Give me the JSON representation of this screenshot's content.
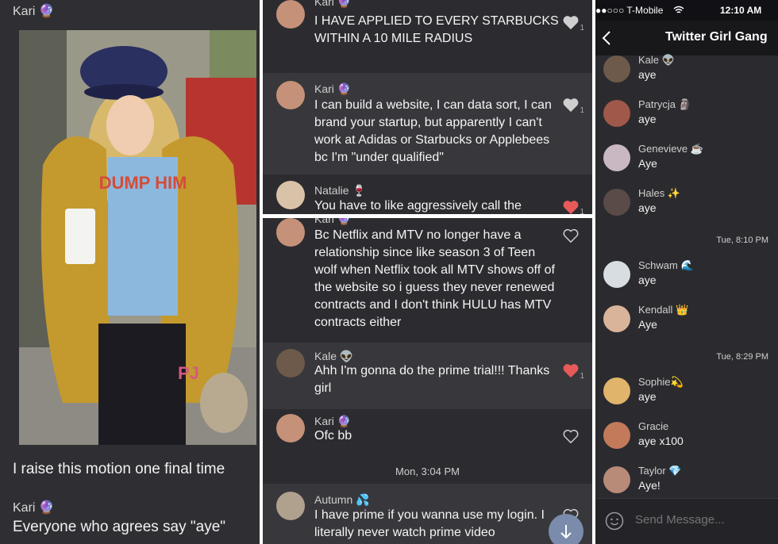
{
  "panel1": {
    "sender_top": "Kari 🔮",
    "photo_shirt_text": "DUMP HIM",
    "photo_pants_text": "PJ",
    "message1": "I raise this motion one final time",
    "sender2": "Kari 🔮",
    "message2": "Everyone who agrees say \"aye\""
  },
  "panel2": {
    "messages": [
      {
        "name": "Kari 🔮",
        "text": "I HAVE APPLIED TO EVERY STARBUCKS WITHIN A 10 MILE RADIUS",
        "likes": "1"
      },
      {
        "name": "Kari 🔮",
        "text": "I can build a website, I can data sort, I can brand your startup, but apparently I can't work at Adidas or Starbucks or Applebees bc I'm \"under qualified\"",
        "likes": "1"
      },
      {
        "name": "Natalie 🍷",
        "text": "You have to like aggressively call the",
        "likes": "1"
      }
    ]
  },
  "panel3": {
    "messages": [
      {
        "name": "Kari 🔮",
        "text": "Bc Netflix and MTV no longer have a relationship since like season 3 of Teen wolf when Netflix took all MTV shows off of the website so i guess they never renewed contracts and I don't think HULU has MTV contracts either"
      },
      {
        "name": "Kale 👽",
        "text": "Ahh I'm gonna do the prime trial!!! Thanks girl",
        "likes": "1"
      },
      {
        "name": "Kari 🔮",
        "text": "Ofc bb"
      },
      {
        "name": "Autumn 💦",
        "text": "I have prime if you wanna use my login. I literally never watch prime video"
      }
    ],
    "date_divider": "Mon, 3:04 PM"
  },
  "panel4": {
    "status": {
      "carrier": "●●○○○ T-Mobile",
      "time": "12:10 AM"
    },
    "title": "Twitter Girl Gang",
    "chats": [
      {
        "name": "Kale 👽",
        "text": "aye"
      },
      {
        "name": "Patrycja 🗿",
        "text": "aye"
      },
      {
        "name": "Genevieve ☕",
        "text": "Aye"
      },
      {
        "name": "Hales ✨",
        "text": "aye"
      },
      {
        "name": "Schwam 🌊",
        "text": "aye"
      },
      {
        "name": "Kendall 👑",
        "text": "Aye"
      },
      {
        "name": "Sophie💫",
        "text": "aye"
      },
      {
        "name": "Gracie",
        "text": "aye x100"
      },
      {
        "name": "Taylor 💎",
        "text": "Aye!"
      }
    ],
    "date1": "Tue, 8:10 PM",
    "date2": "Tue, 8:29 PM",
    "composer_placeholder": "Send Message..."
  },
  "colors": {
    "heart_liked": "#e85a5a",
    "heart_empty": "#cfcfcf",
    "background_dark": "#2c2c30"
  }
}
